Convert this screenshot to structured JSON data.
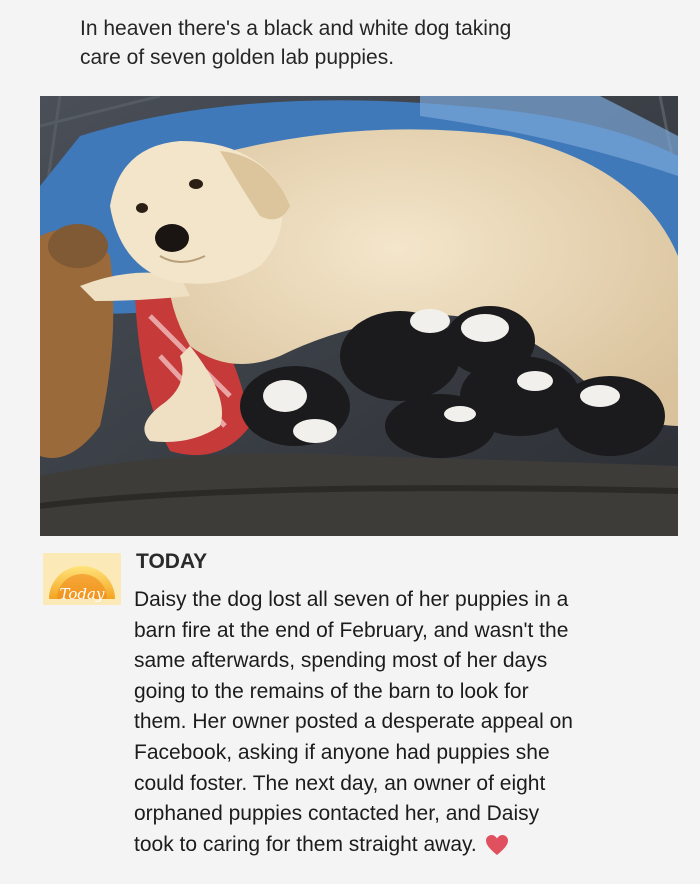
{
  "caption": {
    "lines": [
      "In heaven there's a black and white dog taking",
      "care of seven golden lab puppies."
    ]
  },
  "photo": {
    "subject": "white dog lying on a blanket nursing black and white puppies",
    "colors": {
      "dog": "#e9d8b9",
      "puppies": "#1b1b1d",
      "blanket": "#3e3c38",
      "blue_bedding": "#3f79b9",
      "red_toy": "#c63a3a"
    }
  },
  "post": {
    "logo_text": "Today",
    "source": "TODAY",
    "lines": [
      "Daisy the dog lost all seven of her puppies in a",
      "barn fire at the end of February, and wasn't the",
      "same afterwards, spending most of her days",
      "going to the remains of the barn to look for",
      "them. Her owner posted a desperate appeal on",
      "Facebook, asking if anyone had puppies she",
      "could foster. The next day, an owner of eight",
      "orphaned puppies contacted her, and Daisy",
      "took to caring for them straight away."
    ],
    "heart_icon": "heart-icon",
    "heart_color": "#e0505e"
  }
}
